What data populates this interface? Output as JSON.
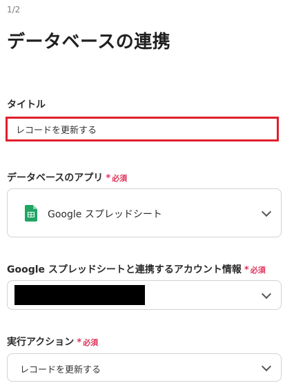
{
  "step_indicator": "1/2",
  "page_title": "データベースの連携",
  "title_field": {
    "label": "タイトル",
    "value": "レコードを更新する"
  },
  "app_field": {
    "label": "データベースのアプリ",
    "required_mark": "*",
    "required_text": "必須",
    "selected_app": "Google スプレッドシート",
    "icon": "google-sheets-icon"
  },
  "account_field": {
    "label": "Google スプレッドシートと連携するアカウント情報",
    "required_mark": "*",
    "required_text": "必須"
  },
  "action_field": {
    "label": "実行アクション",
    "required_mark": "*",
    "required_text": "必須",
    "selected": "レコードを更新する"
  },
  "colors": {
    "required": "#e0325b",
    "highlight_border": "#e01e2b",
    "sheets_green": "#1fa463"
  }
}
